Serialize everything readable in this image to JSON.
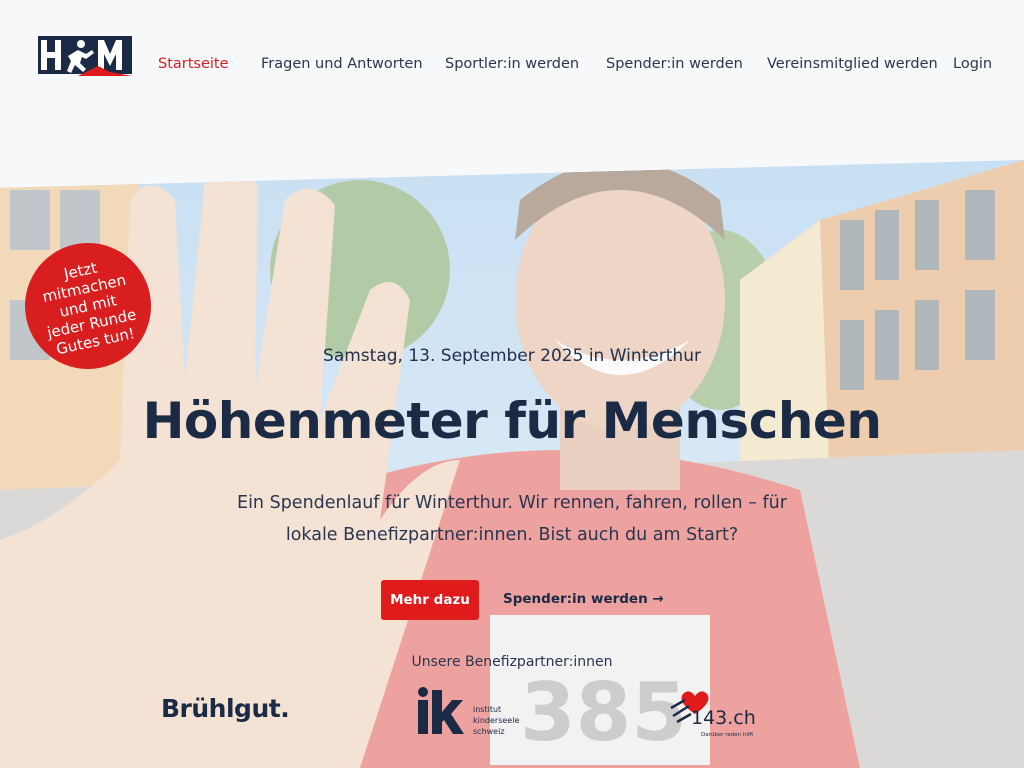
{
  "nav": {
    "items": [
      {
        "label": "Startseite"
      },
      {
        "label": "Fragen und Antworten"
      },
      {
        "label": "Sportler:in werden"
      },
      {
        "label": "Spender:in werden"
      },
      {
        "label": "Vereinsmitglied werden"
      },
      {
        "label": "Login"
      }
    ]
  },
  "hero": {
    "badge": "Jetzt mitmachen und mit jeder Runde Gutes tun!",
    "date": "Samstag, 13. September 2025 in Winterthur",
    "headline": "Höhenmeter für Menschen",
    "subline": "Ein Spendenlauf für Winterthur. Wir rennen, fahren, rollen – für lokale Benefizpartner:innen. Bist auch du am Start?",
    "primary_button": "Mehr dazu",
    "secondary_link": "Spender:in werden →"
  },
  "partners": {
    "title": "Unsere Benefizpartner:innen",
    "bruehlgut": "Brühlgut.",
    "iks_line1": "institut",
    "iks_line2": "kinderseele",
    "iks_line3": "schweiz",
    "p143": "143.ch",
    "p143_tagline": "Darüber reden hilft"
  },
  "race_number": "385",
  "colors": {
    "accent": "#e01b1b",
    "navy": "#1b2a45"
  }
}
